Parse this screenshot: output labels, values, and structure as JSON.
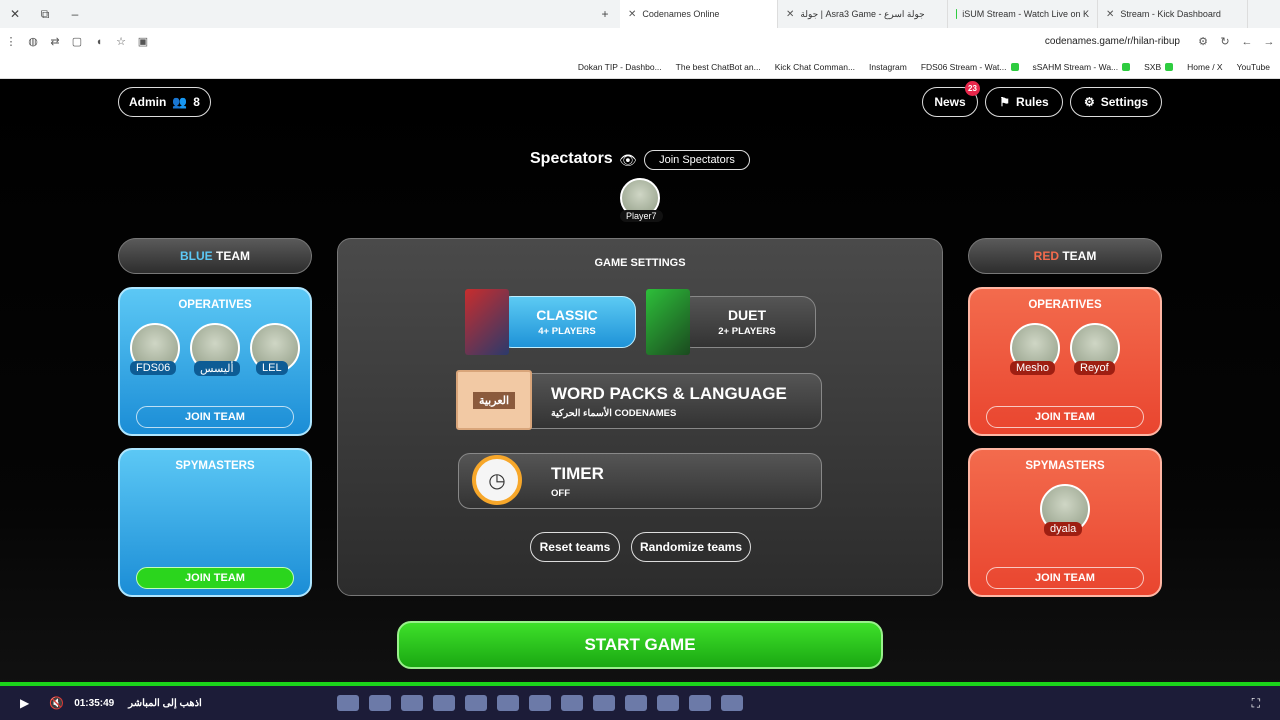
{
  "browser": {
    "tabs": [
      {
        "title": "Codenames Online",
        "active": true
      },
      {
        "title": "جولة | Asra3 Game - جولة اسرع",
        "active": false
      },
      {
        "title": "iSUM Stream - Watch Live on K",
        "active": false
      },
      {
        "title": "Stream - Kick Dashboard",
        "active": false
      }
    ],
    "url": "codenames.game/r/hilan-ribup",
    "bookmarks": [
      "Dokan TIP - Dashbo...",
      "The best ChatBot an...",
      "Kick Chat Comman...",
      "Instagram",
      "FDS06 Stream - Wat...",
      "sSAHM Stream - Wa...",
      "SXB",
      "Home / X",
      "YouTube"
    ]
  },
  "header": {
    "admin_label": "Admin",
    "player_count": "8",
    "news_label": "News",
    "news_badge": "23",
    "rules_label": "Rules",
    "settings_label": "Settings"
  },
  "spectators": {
    "title": "Spectators",
    "join_label": "Join Spectators",
    "players": [
      "Player7"
    ]
  },
  "blue_team": {
    "header_color_word": "BLUE",
    "header_word": "TEAM",
    "operatives_title": "OPERATIVES",
    "operatives": [
      "FDS06",
      "أليسس",
      "LEL"
    ],
    "join_label": "JOIN TEAM",
    "spymasters_title": "SPYMASTERS",
    "spymasters": [],
    "spy_join_label": "JOIN TEAM"
  },
  "red_team": {
    "header_color_word": "RED",
    "header_word": "TEAM",
    "operatives_title": "OPERATIVES",
    "operatives": [
      "Mesho",
      "Reyof"
    ],
    "join_label": "JOIN TEAM",
    "spymasters_title": "SPYMASTERS",
    "spymasters": [
      "dyala"
    ],
    "spy_join_label": "JOIN TEAM"
  },
  "game_settings": {
    "title": "GAME SETTINGS",
    "classic": {
      "title": "CLASSIC",
      "sub": "4+ PLAYERS"
    },
    "duet": {
      "title": "DUET",
      "sub": "2+ PLAYERS"
    },
    "word_packs": {
      "title": "WORD PACKS & LANGUAGE",
      "sub": "الأسماء الحركية CODENAMES",
      "box_label": "العربية"
    },
    "timer": {
      "title": "TIMER",
      "sub": "OFF"
    },
    "reset_label": "Reset teams",
    "randomize_label": "Randomize teams"
  },
  "start_label": "START GAME",
  "taskbar": {
    "time": "01:35:49",
    "live_label": "اذهب إلى المباشر"
  },
  "colors": {
    "blue": "#1b8dd6",
    "red": "#e9452f",
    "green": "#2bd51d"
  }
}
